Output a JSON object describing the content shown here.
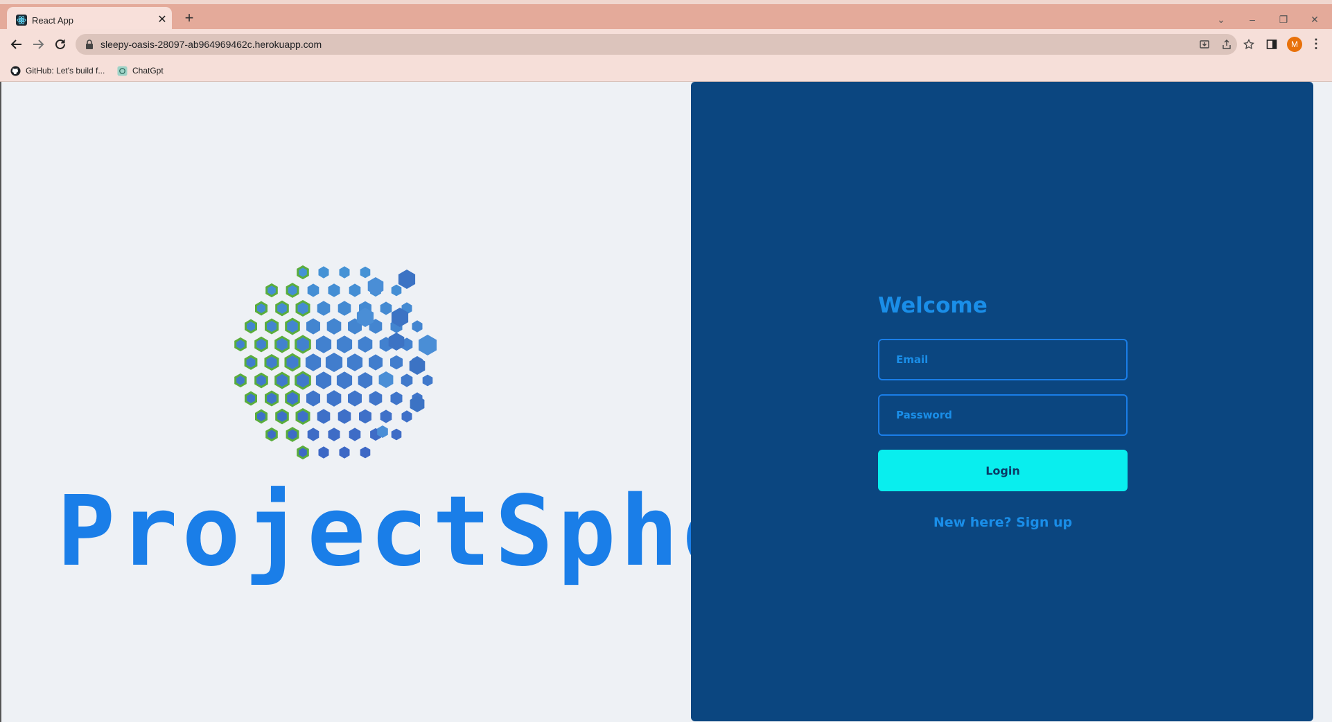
{
  "browser": {
    "tab_title": "React App",
    "url": "sleepy-oasis-28097-ab964969462c.herokuapp.com",
    "avatar_letter": "M",
    "bookmarks": [
      {
        "label": "GitHub: Let's build f...",
        "icon": "github-icon"
      },
      {
        "label": "ChatGpt",
        "icon": "chatgpt-icon"
      }
    ]
  },
  "brand": {
    "name": "ProjectSphere",
    "color": "#1a7ee8"
  },
  "login": {
    "heading": "Welcome",
    "email_placeholder": "Email",
    "email_value": "",
    "password_placeholder": "Password",
    "password_value": "",
    "submit_label": "Login",
    "signup_text": "New here? Sign up",
    "panel_color": "#0b4680",
    "button_color": "#09eeee"
  }
}
